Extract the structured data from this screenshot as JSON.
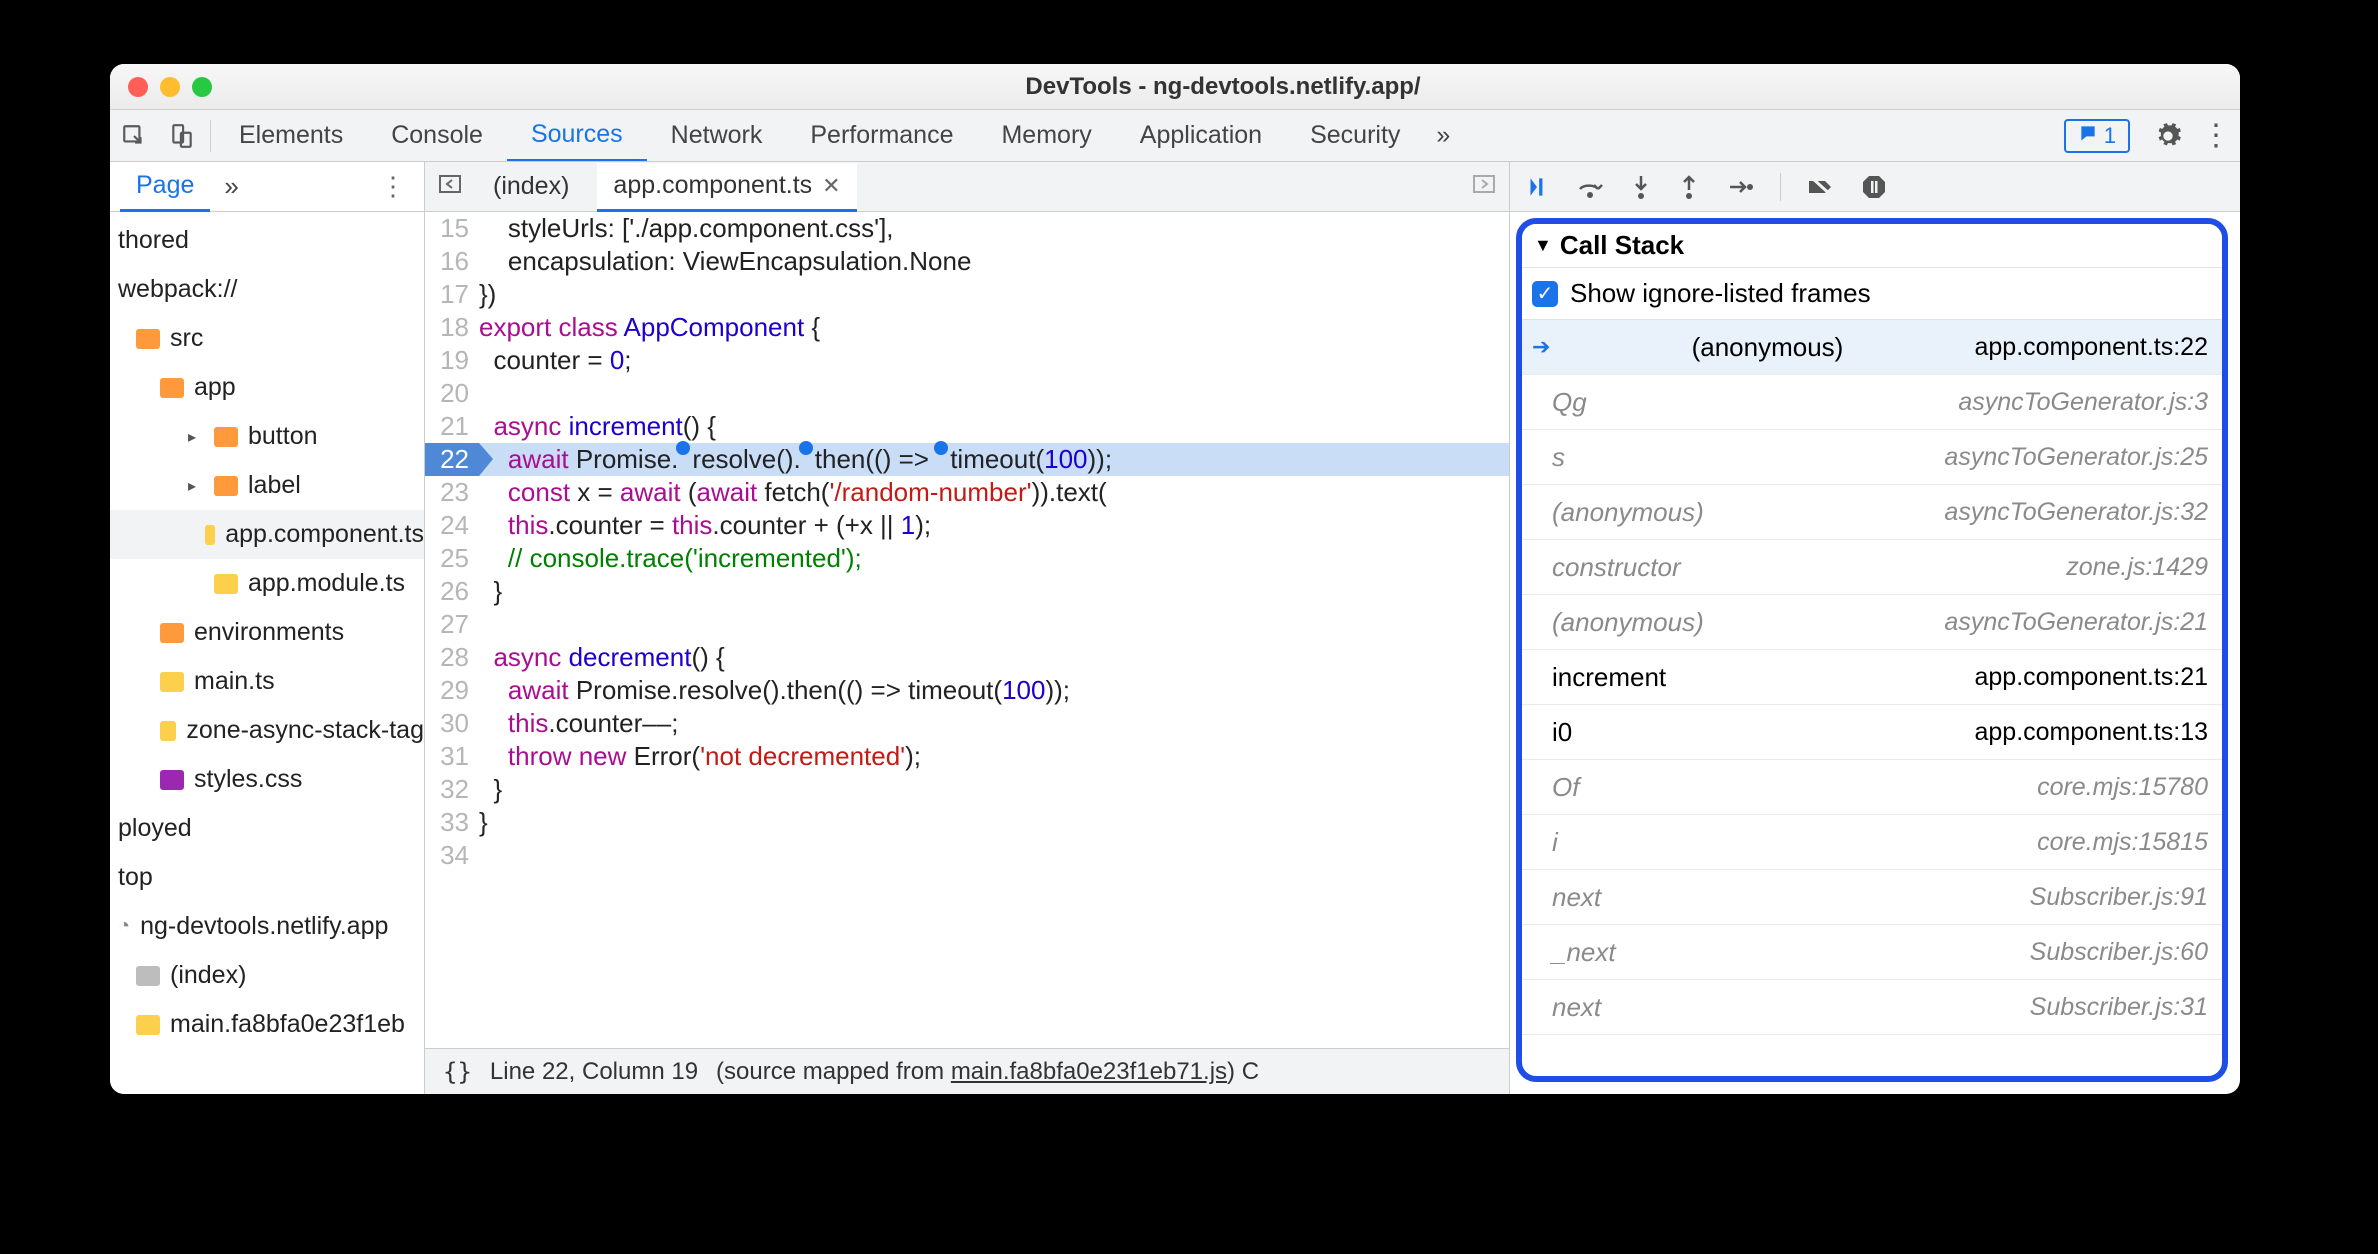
{
  "window_title": "DevTools - ng-devtools.netlify.app/",
  "tabs": {
    "elements": "Elements",
    "console": "Console",
    "sources": "Sources",
    "network": "Network",
    "performance": "Performance",
    "memory": "Memory",
    "application": "Application",
    "security": "Security"
  },
  "message_count": "1",
  "nav_tab": "Page",
  "tree": {
    "l0a": "thored",
    "l0b": "webpack://",
    "src": "src",
    "app": "app",
    "button": "button",
    "label": "label",
    "appcomp": "app.component.ts",
    "appmod": "app.module.ts",
    "env": "environments",
    "main": "main.ts",
    "zone": "zone-async-stack-tag",
    "styles": "styles.css",
    "ployed": "ployed",
    "top": "top",
    "domain": "ng-devtools.netlify.app",
    "index": "(index)",
    "mainfa": "main.fa8bfa0e23f1eb"
  },
  "editor": {
    "tab_index": "(index)",
    "tab_active": "app.component.ts",
    "lines": {
      "l15": "    styleUrls: ['./app.component.css'],",
      "l16": "    encapsulation: ViewEncapsulation.None",
      "l17": "})",
      "l18a": "export",
      "l18b": " class",
      "l18c": " AppComponent",
      " l18d": " {",
      "l19a": "  counter = ",
      "l19b": "0",
      "l19c": ";",
      "l21a": "  async",
      "l21b": " increment",
      "l21c": "() {",
      "l22a": "    await",
      "l22b": " Promise.",
      "l22c": "resolve",
      "l22d": "().",
      "l22e": "then",
      "l22f": "(() => ",
      "l22g": "timeout",
      "l22h": "(",
      "l22i": "100",
      "l22j": "));",
      "l23a": "    const",
      "l23b": " x = ",
      "l23c": "await",
      "l23d": " (",
      "l23e": "await",
      "l23f": " fetch(",
      "l23g": "'/random-number'",
      "l23h": ")).text(",
      "l24a": "    this",
      "l24b": ".counter = ",
      "l24c": "this",
      "l24d": ".counter + (+x || ",
      "l24e": "1",
      "l24f": ");",
      "l25": "    // console.trace('incremented');",
      "l26": "  }",
      "l28a": "  async",
      "l28b": " decrement",
      "l28c": "() {",
      "l29a": "    await",
      "l29b": " Promise.resolve().then(() => timeout(",
      "l29c": "100",
      "l29d": "));",
      "l30a": "    this",
      "l30b": ".counter––;",
      "l31a": "    throw new",
      "l31b": " Error(",
      "l31c": "'not decremented'",
      "l31d": ");",
      "l32": "  }",
      "l33": "}"
    },
    "status_a": "Line 22, Column 19",
    "status_b": "(source mapped from ",
    "status_link": "main.fa8bfa0e23f1eb71.js",
    "status_c": ") C"
  },
  "debug": {
    "section": "Call Stack",
    "show_ignored": "Show ignore-listed frames",
    "frames": [
      {
        "fn": "(anonymous)",
        "loc": "app.component.ts:22",
        "top": true,
        "ign": false
      },
      {
        "fn": "Qg",
        "loc": "asyncToGenerator.js:3",
        "ign": true
      },
      {
        "fn": "s",
        "loc": "asyncToGenerator.js:25",
        "ign": true
      },
      {
        "fn": "(anonymous)",
        "loc": "asyncToGenerator.js:32",
        "ign": true
      },
      {
        "fn": "constructor",
        "loc": "zone.js:1429",
        "ign": true
      },
      {
        "fn": "(anonymous)",
        "loc": "asyncToGenerator.js:21",
        "ign": true
      },
      {
        "fn": "increment",
        "loc": "app.component.ts:21",
        "ign": false
      },
      {
        "fn": "i0",
        "loc": "app.component.ts:13",
        "ign": false
      },
      {
        "fn": "Of",
        "loc": "core.mjs:15780",
        "ign": true
      },
      {
        "fn": "i",
        "loc": "core.mjs:15815",
        "ign": true
      },
      {
        "fn": "next",
        "loc": "Subscriber.js:91",
        "ign": true
      },
      {
        "fn": "_next",
        "loc": "Subscriber.js:60",
        "ign": true
      },
      {
        "fn": "next",
        "loc": "Subscriber.js:31",
        "ign": true
      }
    ]
  }
}
